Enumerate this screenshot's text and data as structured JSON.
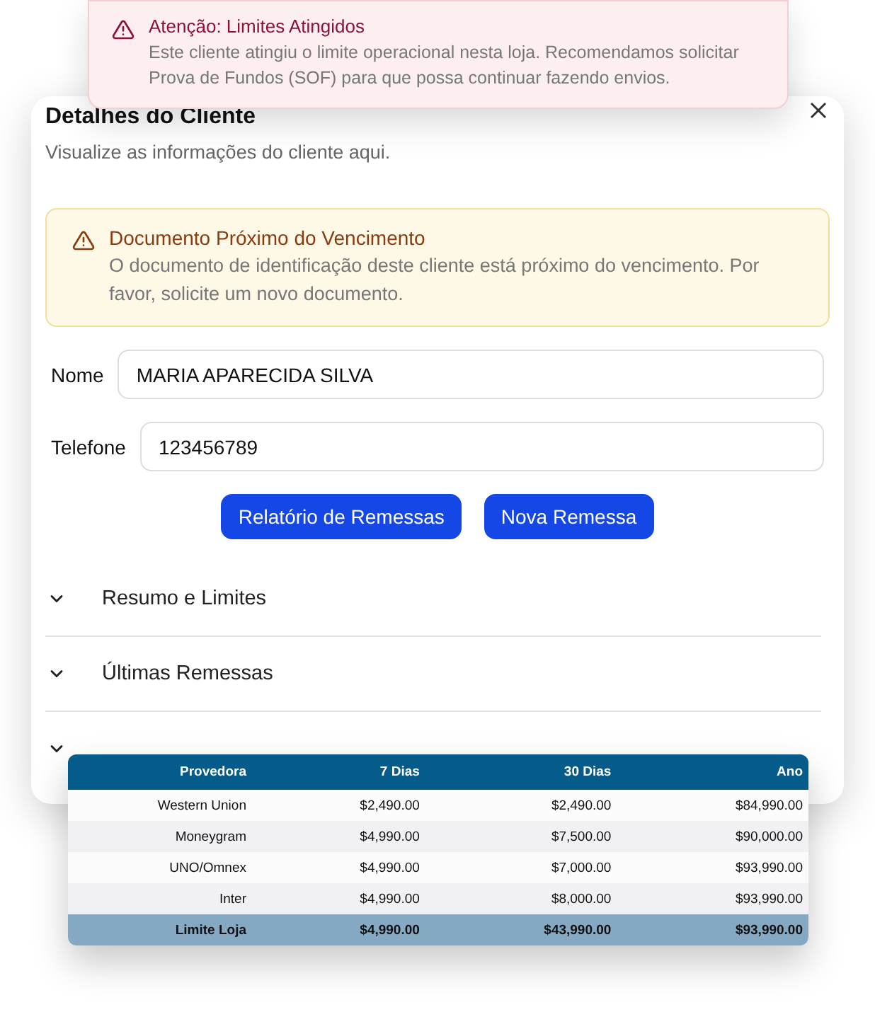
{
  "toast": {
    "title": "Atenção: Limites Atingidos",
    "message": "Este cliente atingiu o limite operacional nesta loja. Recomendamos solicitar Prova de Fundos (SOF) para que possa continuar fazendo envios."
  },
  "dialog": {
    "title": "Detalhes do Cliente",
    "subtitle": "Visualize as informações do cliente aqui.",
    "warning": {
      "title": "Documento Próximo do Vencimento",
      "message": "O documento de identificação deste cliente está próximo do vencimento. Por favor, solicite um novo documento."
    },
    "fields": [
      {
        "label": "Nome",
        "value": "MARIA APARECIDA SILVA"
      },
      {
        "label": "Telefone",
        "value": "123456789"
      }
    ],
    "buttons": [
      "Relatório de Remessas",
      "Nova Remessa"
    ],
    "sections": [
      {
        "label": "Resumo e Limites",
        "expanded": false
      },
      {
        "label": "Últimas Remessas",
        "expanded": false
      },
      {
        "expanded": false
      }
    ]
  },
  "table": {
    "columns": [
      "Provedora",
      "7 Dias",
      "30 Dias",
      "Ano"
    ],
    "rows": [
      [
        "Western Union",
        "$2,490.00",
        "$2,490.00",
        "$84,990.00"
      ],
      [
        "Moneygram",
        "$4,990.00",
        "$7,500.00",
        "$90,000.00"
      ],
      [
        "UNO/Omnex",
        "$4,990.00",
        "$7,000.00",
        "$93,990.00"
      ],
      [
        "Inter",
        "$4,990.00",
        "$8,000.00",
        "$93,990.00"
      ]
    ],
    "total": [
      "Limite Loja",
      "$4,990.00",
      "$43,990.00",
      "$93,990.00"
    ]
  }
}
